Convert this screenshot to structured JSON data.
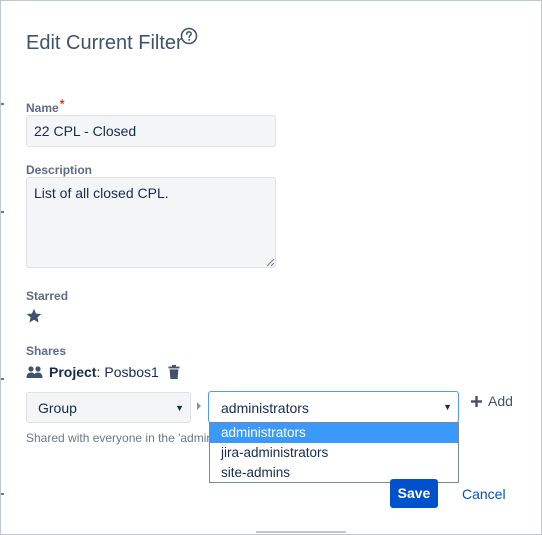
{
  "dialog": {
    "title": "Edit Current Filter"
  },
  "form": {
    "name_label": "Name",
    "required_marker": "*",
    "name_value": "22 CPL - Closed",
    "description_label": "Description",
    "description_value": "List of all closed CPL.",
    "starred_label": "Starred",
    "shares_label": "Shares"
  },
  "share": {
    "type": "Project",
    "separator": ":",
    "name": "Posbos1"
  },
  "new_share": {
    "share_type_select": "Group",
    "group_select": "administrators",
    "add_label": "Add",
    "hint": "Shared with everyone in the 'admin",
    "options": [
      "administrators",
      "jira-administrators",
      "site-admins"
    ],
    "selected_option": "administrators"
  },
  "actions": {
    "save_label": "Save",
    "cancel_label": "Cancel"
  },
  "icons": {
    "help": "help-circle-icon",
    "star": "star-icon",
    "group": "group-icon",
    "trash": "trash-icon",
    "add": "plus-icon",
    "dropdown": "caret-down-icon"
  },
  "colors": {
    "primary": "#0052cc",
    "focus_border": "#4c9aff",
    "option_highlight": "#3b99fc",
    "required": "#de350b"
  }
}
